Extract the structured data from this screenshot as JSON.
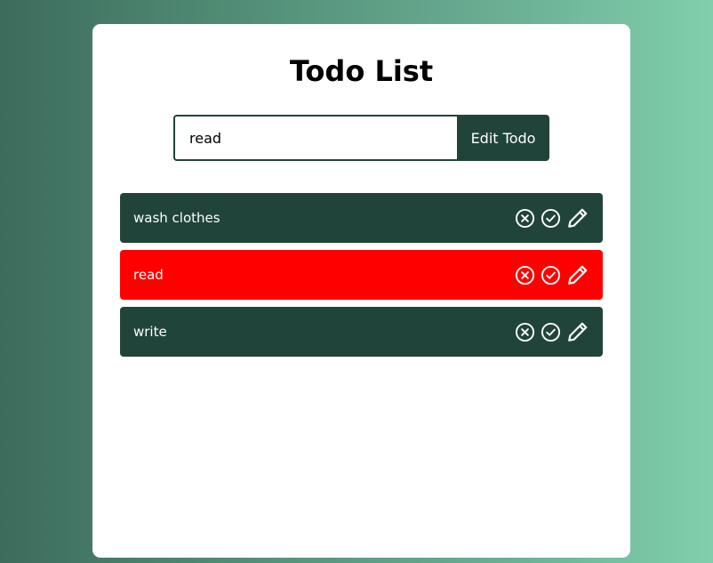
{
  "app": {
    "title": "Todo List"
  },
  "form": {
    "input_value": "read",
    "submit_label": "Edit Todo"
  },
  "todos": [
    {
      "text": "wash clothes",
      "state": "normal"
    },
    {
      "text": "read",
      "state": "editing"
    },
    {
      "text": "write",
      "state": "normal"
    }
  ],
  "icons": {
    "delete": "circle-x-icon",
    "complete": "circle-check-icon",
    "edit": "pencil-icon"
  },
  "colors": {
    "accent": "#21443a",
    "editing": "#ff0000",
    "card": "#ffffff"
  }
}
